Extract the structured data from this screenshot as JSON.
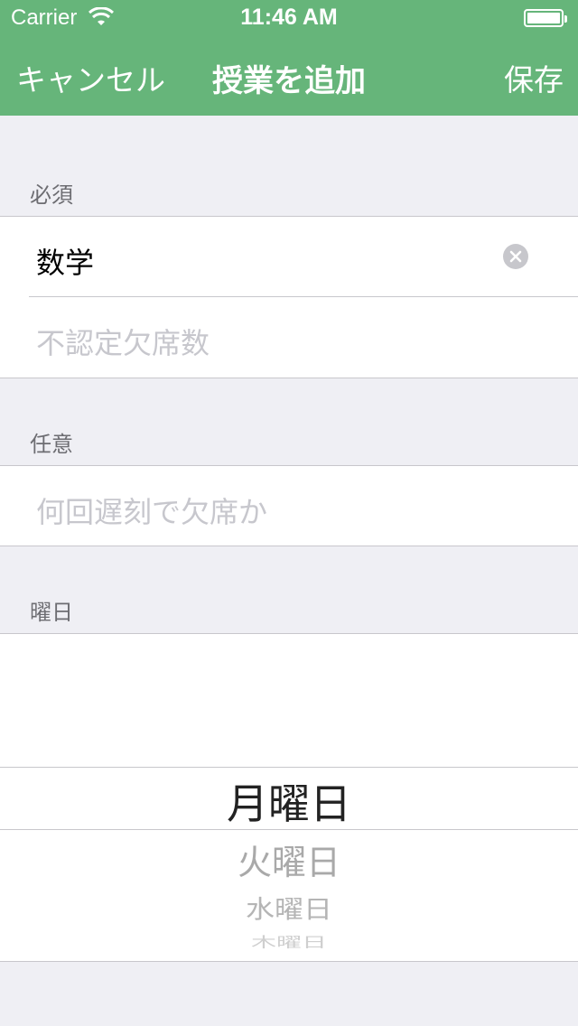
{
  "status": {
    "carrier": "Carrier",
    "time": "11:46 AM"
  },
  "nav": {
    "cancel": "キャンセル",
    "title": "授業を追加",
    "save": "保存"
  },
  "colors": {
    "accent": "#66b57a",
    "background": "#efeff4",
    "placeholder": "#c7c7cd"
  },
  "sections": {
    "required": {
      "header": "必須",
      "subject_value": "数学",
      "absence_placeholder": "不認定欠席数"
    },
    "optional": {
      "header": "任意",
      "late_placeholder": "何回遅刻で欠席か"
    },
    "weekday": {
      "header": "曜日",
      "options": [
        "月曜日",
        "火曜日",
        "水曜日",
        "木曜日"
      ],
      "selected": "月曜日"
    }
  },
  "icons": {
    "wifi": "wifi-icon",
    "battery": "battery-icon",
    "clear": "clear-icon"
  }
}
